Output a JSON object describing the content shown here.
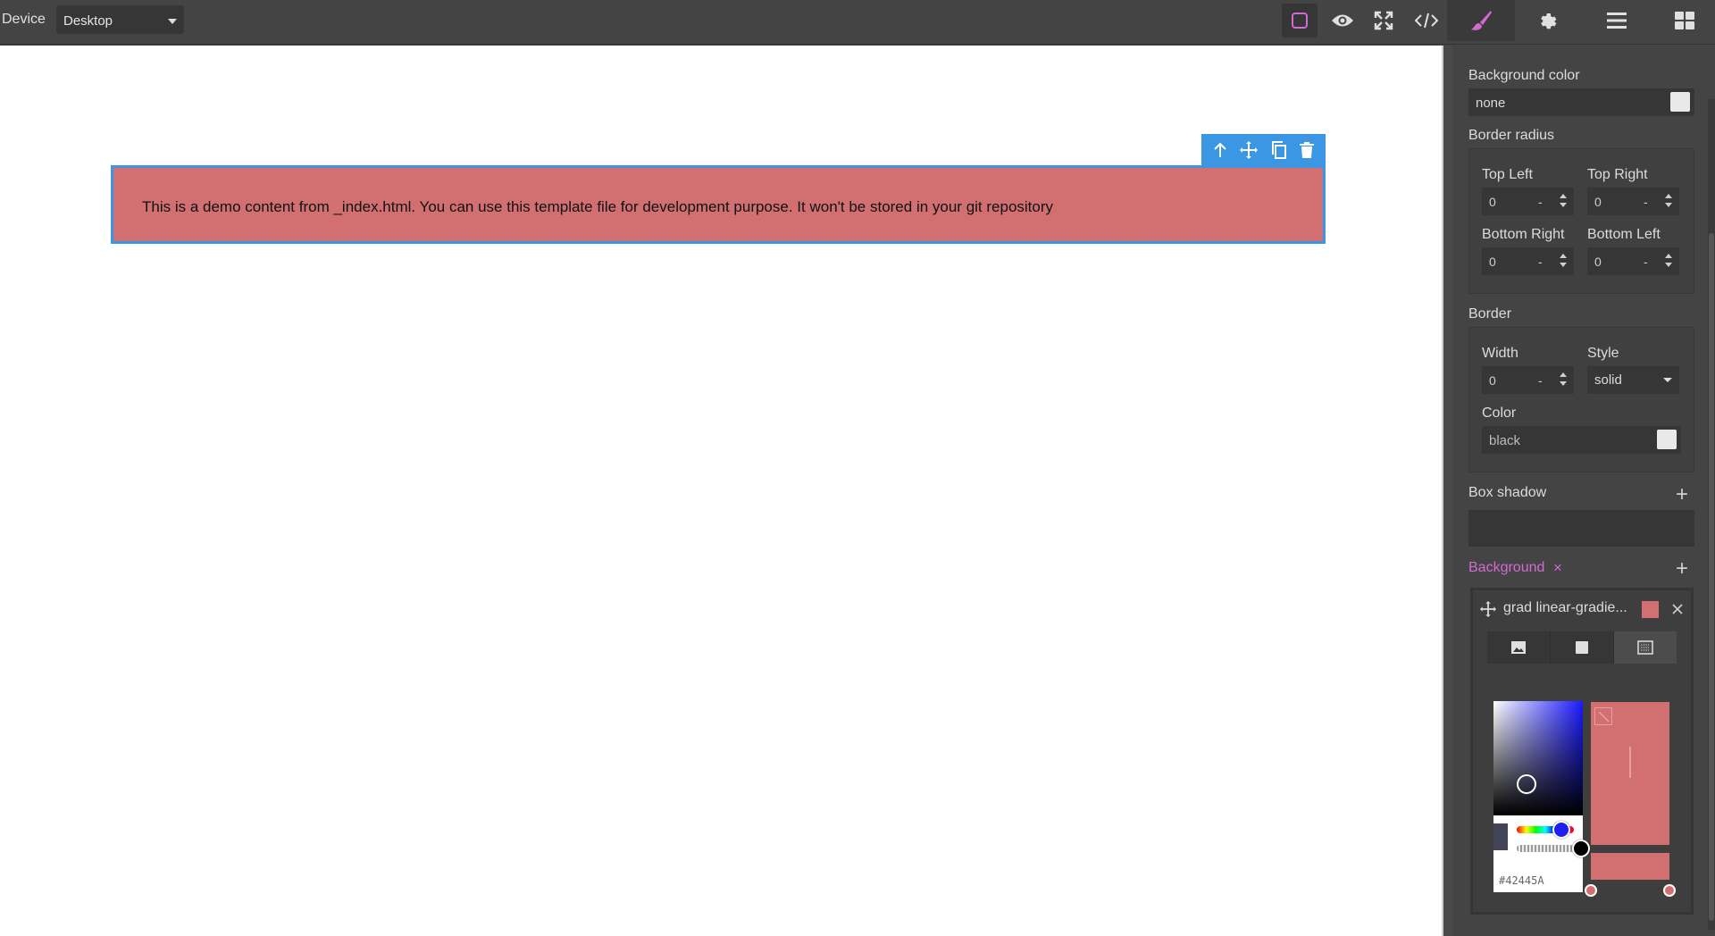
{
  "topbar": {
    "device_label": "Device",
    "device_value": "Desktop",
    "icons": [
      "sw-visibility-icon",
      "preview-eye-icon",
      "fullscreen-icon",
      "code-icon"
    ],
    "panel_tabs": [
      "style-manager-brush-icon",
      "settings-gear-icon",
      "layer-manager-menu-icon",
      "blocks-grid-icon"
    ]
  },
  "canvas": {
    "demo_text": "This is a demo content from _index.html. You can use this template file for development purpose. It won't be stored in your git repository",
    "toolbar_icons": [
      "arrow-up-icon",
      "move-icon",
      "copy-icon",
      "delete-icon"
    ]
  },
  "style_panel": {
    "background_color": {
      "label": "Background color",
      "value": "none"
    },
    "border_radius": {
      "label": "Border radius",
      "top_left": {
        "label": "Top Left",
        "value": "0",
        "unit": "-"
      },
      "top_right": {
        "label": "Top Right",
        "value": "0",
        "unit": "-"
      },
      "bottom_right": {
        "label": "Bottom Right",
        "value": "0",
        "unit": "-"
      },
      "bottom_left": {
        "label": "Bottom Left",
        "value": "0",
        "unit": "-"
      }
    },
    "border": {
      "label": "Border",
      "width": {
        "label": "Width",
        "value": "0",
        "unit": "-"
      },
      "style": {
        "label": "Style",
        "value": "solid"
      },
      "color": {
        "label": "Color",
        "value": "black"
      }
    },
    "box_shadow": {
      "label": "Box shadow"
    },
    "background": {
      "label": "Background",
      "clear_icon": "×",
      "layer_title": "grad linear-gradie...",
      "layer_color": "#d27071",
      "picker_hex": "#42445A"
    }
  },
  "colors": {
    "accent": "#3b97e3",
    "brand_pink": "#d36ad4",
    "demo_bg": "#d27071"
  }
}
